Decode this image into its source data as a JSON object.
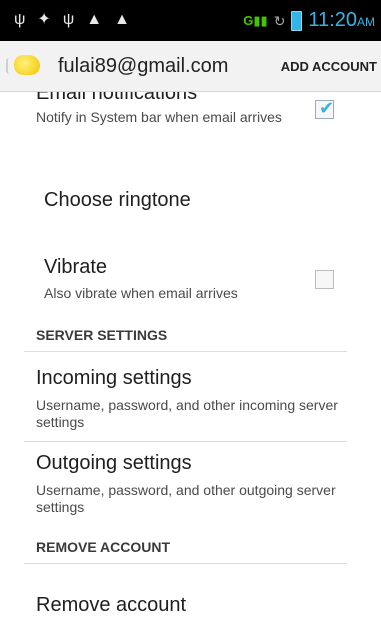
{
  "status_bar": {
    "icons": [
      "usb-icon",
      "android-icon",
      "usb-icon",
      "warning-icon",
      "warning-icon"
    ],
    "signal_label": "G",
    "time": "11:20",
    "ampm": "AM"
  },
  "action_bar": {
    "account_email": "fulai89@gmail.com",
    "add_account_label": "ADD ACCOUNT"
  },
  "settings": {
    "email_notifications": {
      "title": "Email notifications",
      "summary": "Notify in System bar when email arrives",
      "checked": true
    },
    "choose_ringtone": {
      "title": "Choose ringtone"
    },
    "vibrate": {
      "title": "Vibrate",
      "summary": "Also vibrate when email arrives",
      "checked": false
    },
    "server_settings_header": "SERVER SETTINGS",
    "incoming": {
      "title": "Incoming settings",
      "summary": "Username, password, and other incoming server settings"
    },
    "outgoing": {
      "title": "Outgoing settings",
      "summary": "Username, password, and other outgoing server settings"
    },
    "remove_account_header": "REMOVE ACCOUNT",
    "remove_account": {
      "title": "Remove account"
    }
  },
  "colors": {
    "accent": "#33b5e5",
    "signal": "#46c400"
  }
}
